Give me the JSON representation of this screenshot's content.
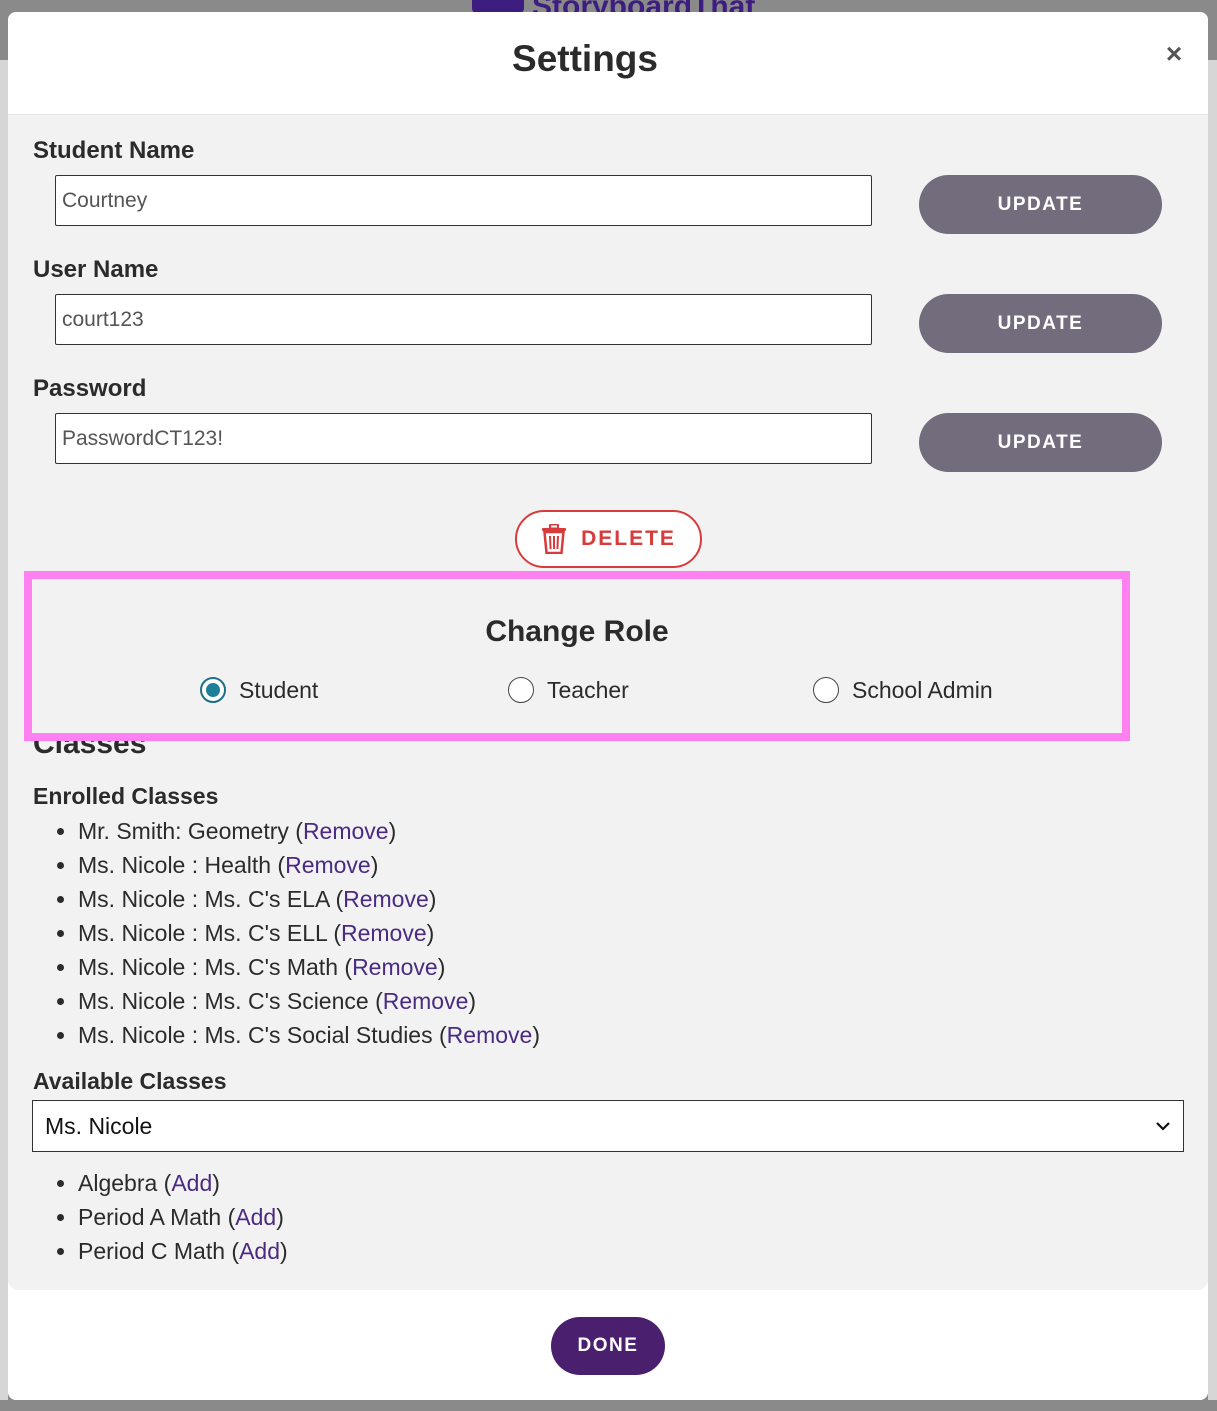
{
  "background": {
    "brand": "StoryboardThat"
  },
  "modal": {
    "title": "Settings",
    "close_label": "×"
  },
  "fields": {
    "student_name": {
      "label": "Student Name",
      "value": "Courtney",
      "button": "UPDATE"
    },
    "user_name": {
      "label": "User Name",
      "value": "court123",
      "button": "UPDATE"
    },
    "password": {
      "label": "Password",
      "value": "PasswordCT123!",
      "button": "UPDATE"
    }
  },
  "delete_label": "DELETE",
  "role": {
    "title": "Change Role",
    "options": [
      {
        "label": "Student",
        "checked": true
      },
      {
        "label": "Teacher",
        "checked": false
      },
      {
        "label": "School Admin",
        "checked": false
      }
    ]
  },
  "classes": {
    "heading": "Classes",
    "enrolled_heading": "Enrolled Classes",
    "remove_label": "Remove",
    "enrolled": [
      {
        "name": "Mr. Smith: Geometry"
      },
      {
        "name": "Ms. Nicole : Health"
      },
      {
        "name": "Ms. Nicole : Ms. C's ELA"
      },
      {
        "name": "Ms. Nicole : Ms. C's ELL"
      },
      {
        "name": "Ms. Nicole : Ms. C's Math"
      },
      {
        "name": "Ms. Nicole : Ms. C's Science"
      },
      {
        "name": "Ms. Nicole : Ms. C's Social Studies"
      }
    ],
    "available_heading": "Available Classes",
    "teacher_select": "Ms. Nicole",
    "add_label": "Add",
    "available": [
      {
        "name": "Algebra"
      },
      {
        "name": "Period A Math"
      },
      {
        "name": "Period C Math"
      }
    ]
  },
  "done_label": "DONE",
  "colors": {
    "highlight": "#ff80f0",
    "update_button": "#726c7d",
    "delete": "#d83b3b",
    "done_button": "#4a1f6e",
    "link": "#4b2b82",
    "radio_checked": "#1d7f99"
  }
}
